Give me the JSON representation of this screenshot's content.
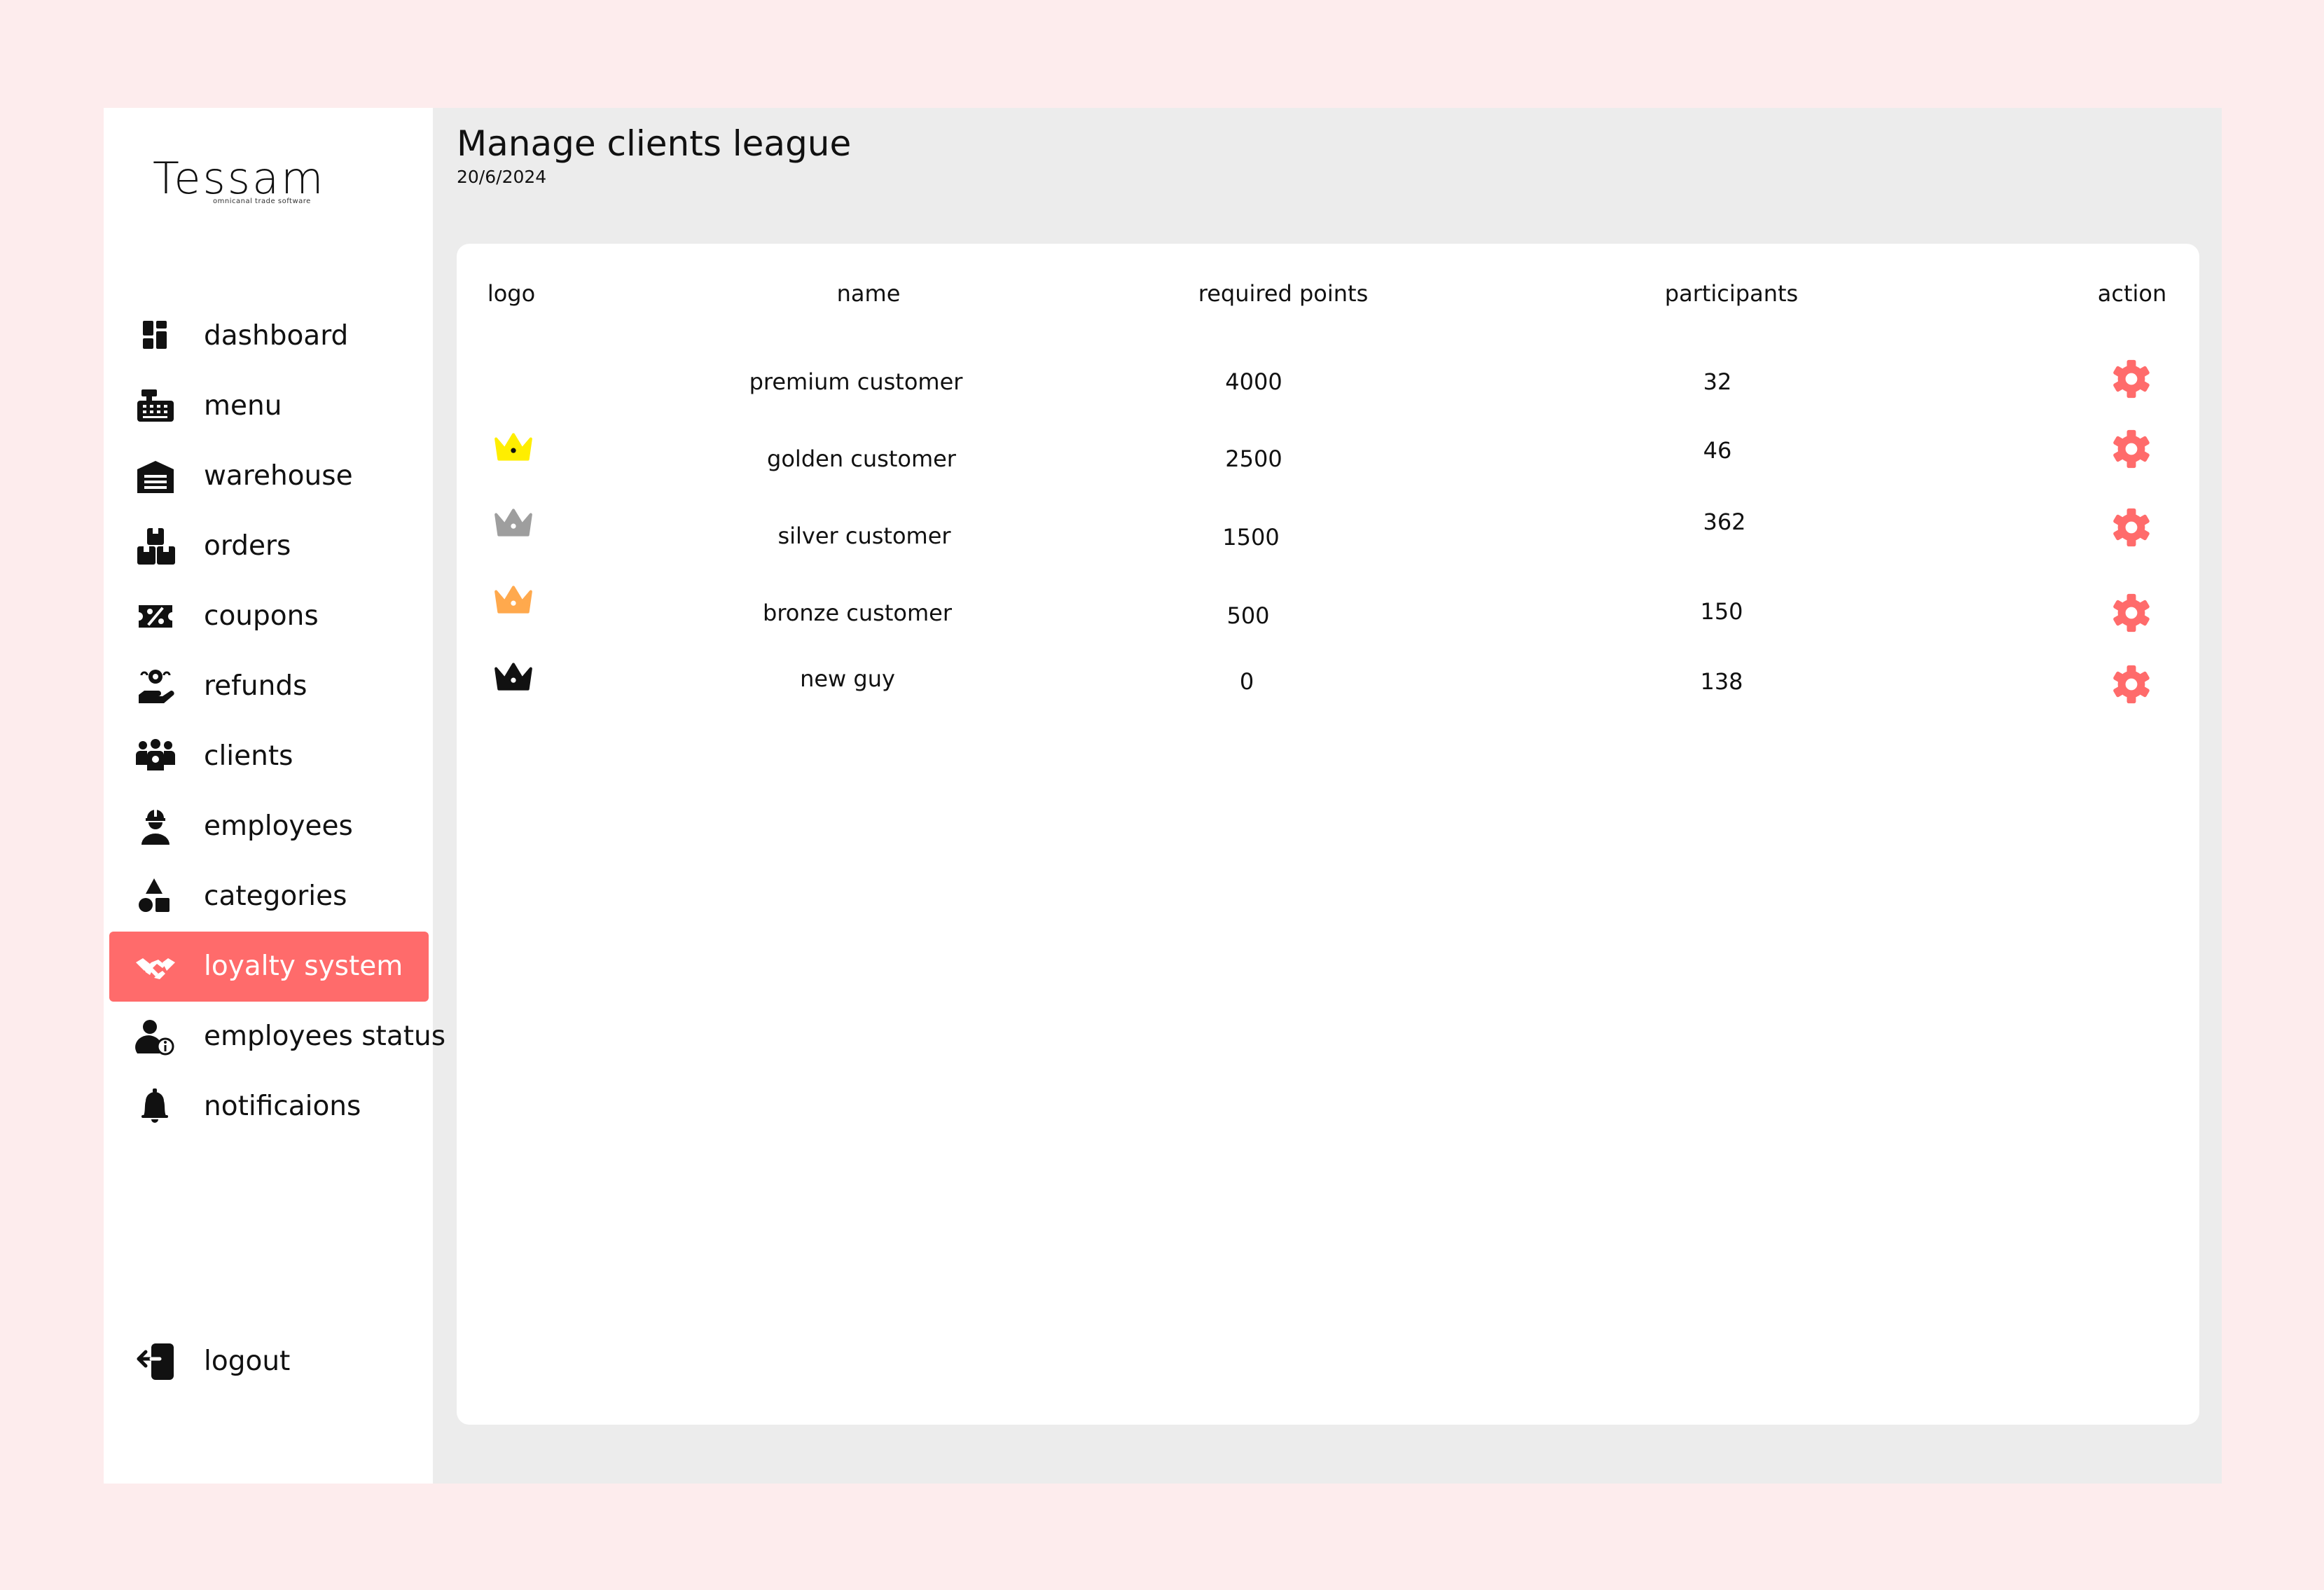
{
  "brand": {
    "name": "Tessam",
    "tagline": "omnicanal trade software"
  },
  "sidebar": {
    "items": [
      {
        "label": "dashboard",
        "icon": "dashboard-icon"
      },
      {
        "label": "menu",
        "icon": "cash-register-icon"
      },
      {
        "label": "warehouse",
        "icon": "warehouse-icon"
      },
      {
        "label": "orders",
        "icon": "boxes-icon"
      },
      {
        "label": "coupons",
        "icon": "coupon-icon"
      },
      {
        "label": "refunds",
        "icon": "refund-icon"
      },
      {
        "label": "clients",
        "icon": "clients-icon"
      },
      {
        "label": "employees",
        "icon": "worker-icon"
      },
      {
        "label": "categories",
        "icon": "shapes-icon"
      },
      {
        "label": "loyalty system",
        "icon": "handshake-icon",
        "active": true
      },
      {
        "label": "employees status",
        "icon": "user-info-icon"
      },
      {
        "label": "notificaions",
        "icon": "bell-icon"
      }
    ],
    "logout": {
      "label": "logout",
      "icon": "logout-icon"
    }
  },
  "header": {
    "title": "Manage clients league",
    "date": "20/6/2024"
  },
  "table": {
    "columns": [
      "logo",
      "name",
      "required points",
      "participants",
      "action"
    ],
    "rows": [
      {
        "logo": null,
        "name": "premium customer",
        "required_points": "4000",
        "participants": "32"
      },
      {
        "logo": "crown-icon",
        "logo_color": "#ffee00",
        "name": "golden customer",
        "required_points": "2500",
        "participants": "46"
      },
      {
        "logo": "crown-icon",
        "logo_color": "#9e9e9e",
        "name": "silver customer",
        "required_points": "1500",
        "participants": "362"
      },
      {
        "logo": "crown-icon",
        "logo_color": "#ffa94d",
        "name": "bronze customer",
        "required_points": "500",
        "participants": "150"
      },
      {
        "logo": "crown-icon",
        "logo_color": "#111111",
        "name": "new  guy",
        "required_points": "0",
        "participants": "138"
      }
    ],
    "action_icon": "gear-icon",
    "action_color": "#ff6b6b"
  },
  "colors": {
    "page_background": "#fdeced",
    "app_background": "#ececec",
    "accent": "#ff6b6b"
  }
}
